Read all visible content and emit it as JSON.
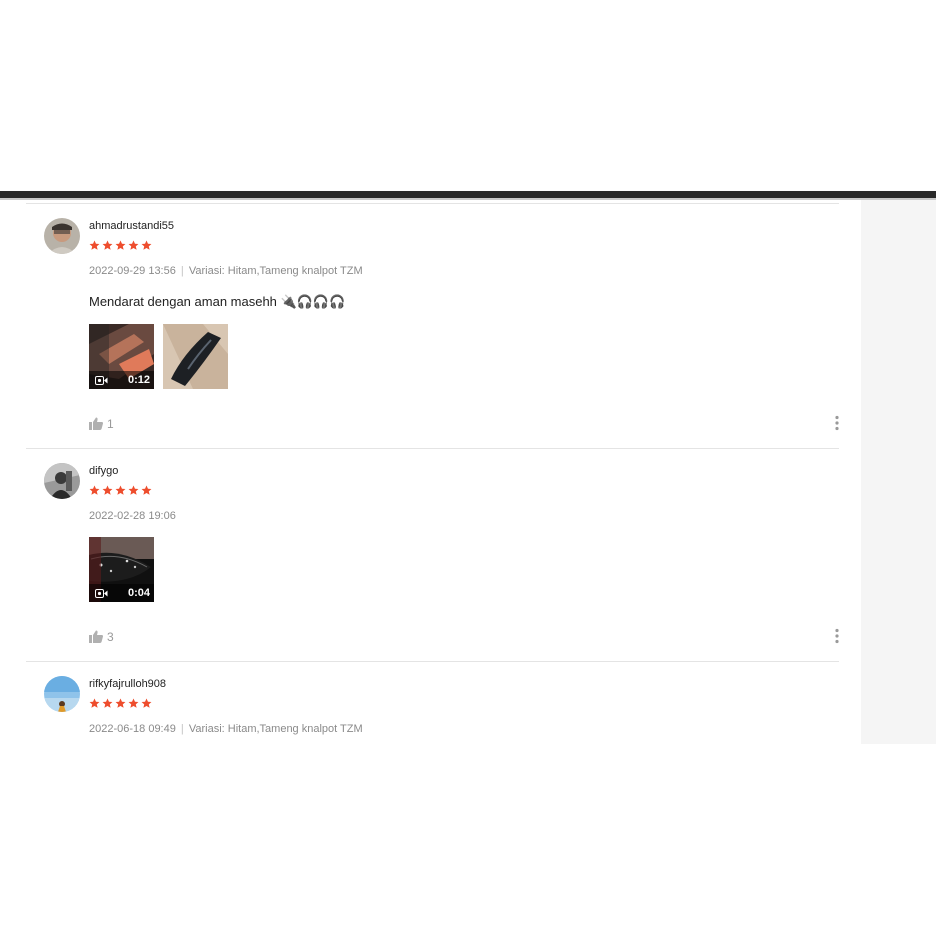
{
  "colors": {
    "star": "#ee4d2d",
    "muted": "#8a8a8a",
    "text": "#222222",
    "divider": "#e4e4e4",
    "sidebar": "#f5f5f5"
  },
  "reviews": [
    {
      "username": "ahmadrustandi55",
      "rating": 5,
      "date": "2022-09-29 13:56",
      "separator": "|",
      "variant": "Variasi: Hitam,Tameng knalpot TZM",
      "comment": "Mendarat dengan aman masehh 🔌🎧🎧🎧",
      "media": [
        {
          "type": "video",
          "duration": "0:12",
          "icon": "video-camera-icon"
        },
        {
          "type": "image"
        }
      ],
      "likes": "1",
      "like_icon": "thumbs-up-icon",
      "more_icon": "more-vertical-icon"
    },
    {
      "username": "difygo",
      "rating": 5,
      "date": "2022-02-28 19:06",
      "media": [
        {
          "type": "video",
          "duration": "0:04",
          "icon": "video-camera-icon"
        }
      ],
      "likes": "3",
      "like_icon": "thumbs-up-icon",
      "more_icon": "more-vertical-icon"
    },
    {
      "username": "rifkyfajrulloh908",
      "rating": 5,
      "date": "2022-06-18 09:49",
      "separator": "|",
      "variant": "Variasi: Hitam,Tameng knalpot TZM"
    }
  ]
}
